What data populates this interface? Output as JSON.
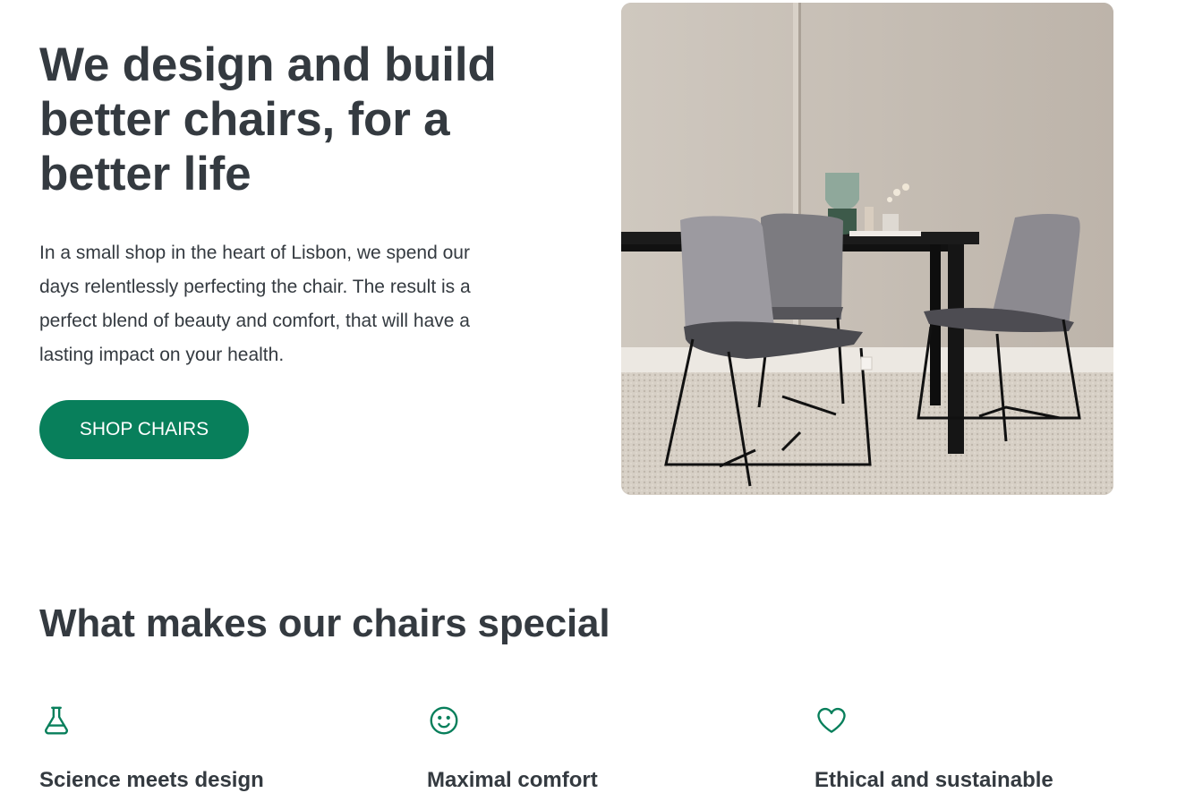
{
  "hero": {
    "title": "We design and build better chairs, for a better life",
    "description": "In a small shop in the heart of Lisbon, we spend our days relentlessly perfecting the chair. The result is a perfect blend of beauty and comfort, that will have a lasting impact on your health.",
    "cta_label": "SHOP CHAIRS",
    "image_icon": "dining-chairs-photo"
  },
  "colors": {
    "accent": "#087f5b",
    "text": "#343a40",
    "background": "#ffffff"
  },
  "features_section": {
    "title": "What makes our chairs special",
    "items": [
      {
        "icon": "flask-icon",
        "title": "Science meets design"
      },
      {
        "icon": "smiley-icon",
        "title": "Maximal comfort"
      },
      {
        "icon": "heart-icon",
        "title": "Ethical and sustainable"
      }
    ]
  }
}
